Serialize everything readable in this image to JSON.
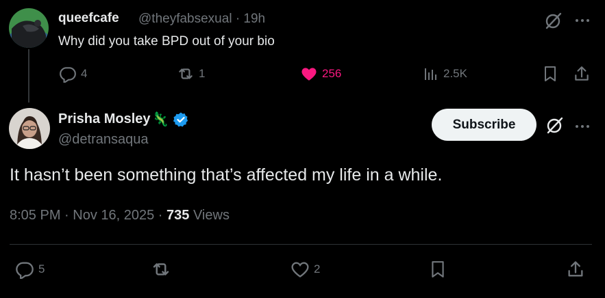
{
  "reply": {
    "display_name": "queefcafe",
    "handle_time": "@theyfabsexual · 19h",
    "text": "Why did you take BPD out of your bio",
    "reply_count": "4",
    "repost_count": "1",
    "like_count": "256",
    "view_count": "2.5K"
  },
  "tweet": {
    "display_name": "Prisha Mosley",
    "name_emoji": "🦎",
    "handle": "@detransaqua",
    "subscribe_label": "Subscribe",
    "text": "It hasn’t been something that’s affected my life in a while.",
    "timestamp": "8:05 PM · Nov 16, 2025 · ",
    "views_count": "735",
    "views_label": "Views",
    "reply_count": "5",
    "like_count": "2"
  },
  "colors": {
    "background": "#000000",
    "text_primary": "#e7e9ea",
    "text_secondary": "#71767b",
    "like_active": "#f91880",
    "verified": "#1d9bf0",
    "button_bg": "#eff3f4"
  }
}
